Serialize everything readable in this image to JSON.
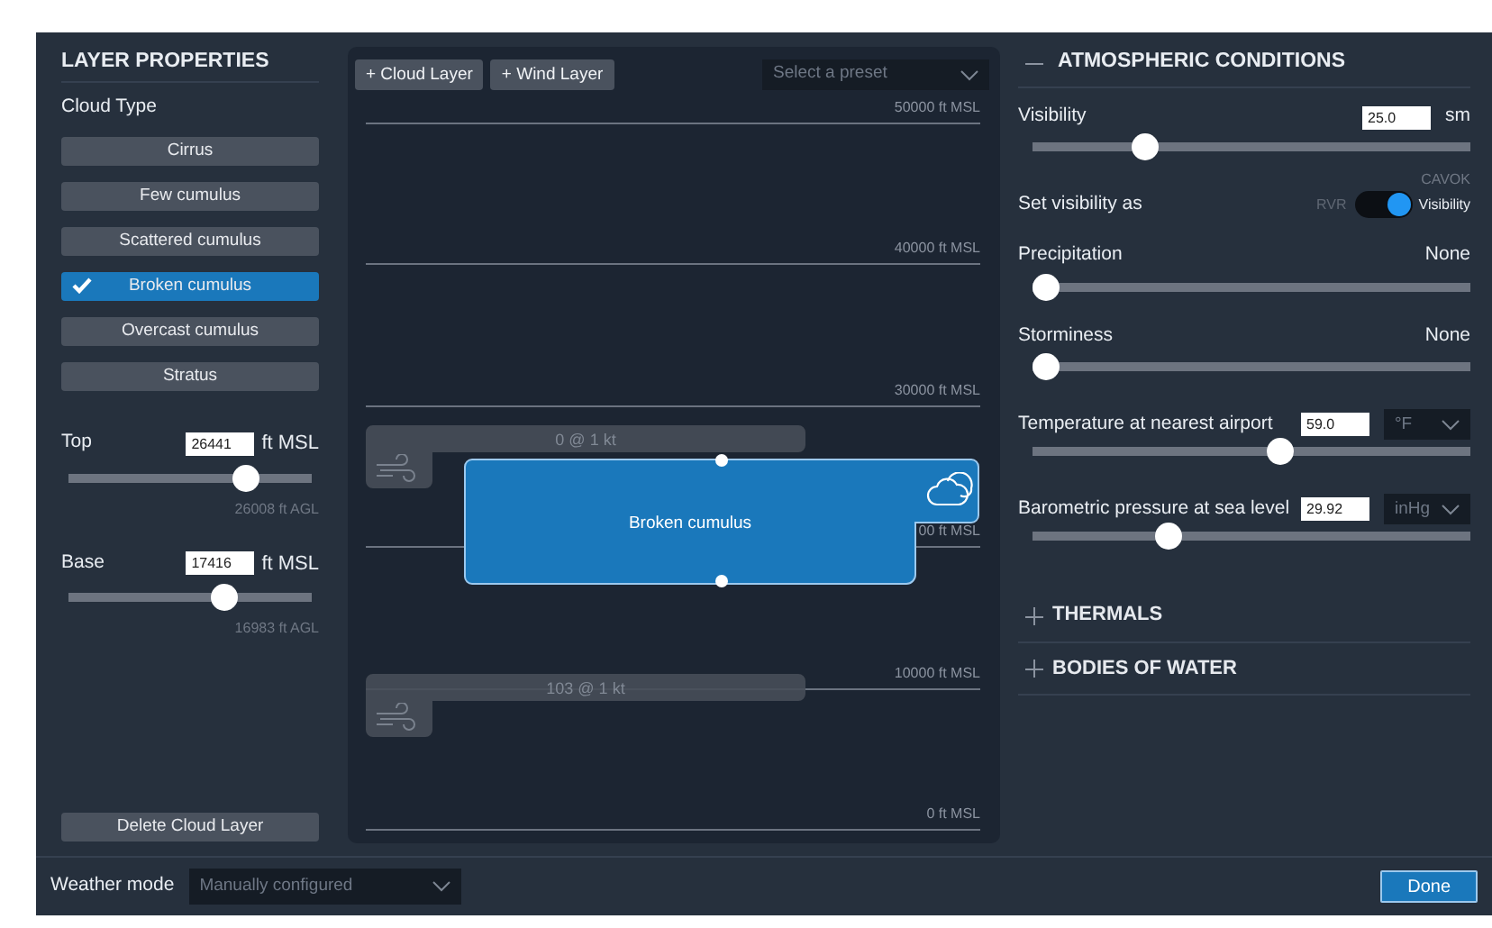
{
  "layer_properties": {
    "title": "LAYER PROPERTIES",
    "cloud_type_label": "Cloud Type",
    "cloud_types": [
      {
        "label": "Cirrus",
        "selected": false
      },
      {
        "label": "Few cumulus",
        "selected": false
      },
      {
        "label": "Scattered cumulus",
        "selected": false
      },
      {
        "label": "Broken cumulus",
        "selected": true
      },
      {
        "label": "Overcast cumulus",
        "selected": false
      },
      {
        "label": "Stratus",
        "selected": false
      }
    ],
    "altitudes": [
      {
        "label": "Top",
        "value": "26441",
        "unit": "ft MSL",
        "level": 0.76,
        "agl": "26008 ft AGL"
      },
      {
        "label": "Base",
        "value": "17416",
        "unit": "ft MSL",
        "level": 0.66,
        "agl": "16983 ft AGL"
      }
    ],
    "delete_button": "Delete Cloud Layer"
  },
  "canvas": {
    "buttons": [
      "+ Cloud Layer",
      "+ Wind Layer"
    ],
    "preset": {
      "placeholder": "Select a preset"
    },
    "altitude_lines": [
      {
        "label": "50000 ft MSL"
      },
      {
        "label": "40000 ft MSL"
      },
      {
        "label": "30000 ft MSL"
      },
      {
        "label": "00 ft MSL"
      },
      {
        "label": "10000 ft MSL"
      },
      {
        "label": "0 ft MSL"
      }
    ],
    "wind_layers": [
      {
        "label": "0 @ 1 kt"
      },
      {
        "label": "103 @ 1 kt"
      }
    ],
    "cloud_layer": {
      "label": "Broken cumulus"
    }
  },
  "atmospheric_conditions": {
    "title": "ATMOSPHERIC CONDITIONS",
    "expanded": true,
    "visibility": {
      "label": "Visibility",
      "value": "25.0",
      "unit": "sm",
      "level": 0.24,
      "note": "CAVOK"
    },
    "visibility_mode": {
      "label": "Set visibility as",
      "off_label": "RVR",
      "on_label": "Visibility",
      "on": true
    },
    "rows": [
      {
        "kind": "reading",
        "label": "Precipitation",
        "reading": "None",
        "level": 0
      },
      {
        "kind": "reading",
        "label": "Storminess",
        "reading": "None",
        "level": 0
      },
      {
        "kind": "unit",
        "label": "Temperature at nearest airport",
        "value": "59.0",
        "unit": "°F",
        "level": 0.57
      },
      {
        "kind": "unit",
        "label": "Barometric pressure at sea level",
        "value": "29.92",
        "unit": "inHg",
        "level": 0.3
      }
    ]
  },
  "sections": [
    {
      "title": "THERMALS",
      "expanded": false
    },
    {
      "title": "BODIES OF WATER",
      "expanded": false
    }
  ],
  "footer": {
    "weather_mode_label": "Weather mode",
    "weather_mode": "Manually configured",
    "done_button": "Done"
  }
}
